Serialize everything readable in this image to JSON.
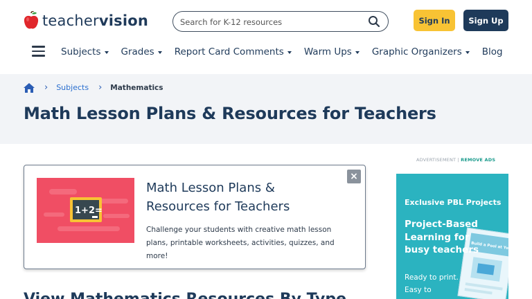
{
  "logo": {
    "part1": "teacher",
    "part2": "vision"
  },
  "search": {
    "placeholder": "Search for K-12 resources"
  },
  "header": {
    "signin": "Sign In",
    "signup": "Sign Up"
  },
  "nav": [
    "Subjects",
    "Grades",
    "Report Card Comments",
    "Warm Ups",
    "Graphic Organizers",
    "Blog"
  ],
  "breadcrumb": {
    "subjects": "Subjects",
    "current": "Mathematics"
  },
  "page_title": "Math Lesson Plans & Resources for Teachers",
  "card": {
    "title": "Math Lesson Plans & Resources for Teachers",
    "description": "Challenge your students with creative math lesson plans, printable worksheets, activities, quizzes, and more!",
    "image_text": "1+2=",
    "close": "×"
  },
  "next_heading": "View Mathematics Resources By Type",
  "ad": {
    "label": "ADVERTISEMENT",
    "remove": "REMOVE ADS",
    "kicker": "Exclusive PBL Projects",
    "headline": "Project-Based Learning for busy teachers",
    "sub": "Ready to print. Easy to implement.",
    "book_title": "Build a Pool at Your School"
  },
  "colors": {
    "navy": "#1e3a5a",
    "signin_bg": "#f8c334",
    "link_blue": "#2b6fcf",
    "band_bg": "#f2f4f7",
    "card_image_bg": "#f04e64",
    "ad_bg": "#2bb3c0",
    "apple_red": "#e0262b"
  }
}
